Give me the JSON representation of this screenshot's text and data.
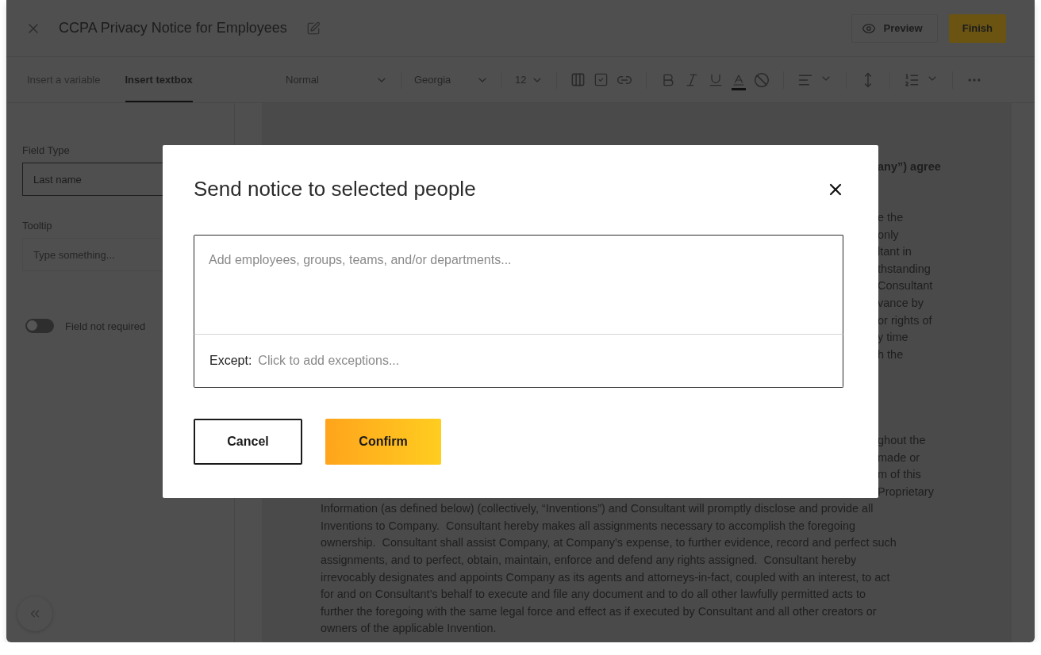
{
  "header": {
    "title": "CCPA Privacy Notice for Employees",
    "buttons": [
      {
        "label": "Preview",
        "kind": "secondary"
      },
      {
        "label": "Finish",
        "kind": "primary"
      }
    ]
  },
  "tabs": [
    {
      "label": "Insert a variable",
      "selected": false
    },
    {
      "label": "Insert textbox",
      "selected": true
    }
  ],
  "toolbar": {
    "dropdowns": [
      {
        "value": "Normal"
      },
      {
        "value": "Georgia"
      },
      {
        "value": "12"
      }
    ]
  },
  "side_panel": {
    "field_type": {
      "label": "Field Type",
      "value": "Last name"
    },
    "tooltip": {
      "label": "Tooltip",
      "placeholder": "Type something..."
    },
    "required_toggle": {
      "label": "Field not required",
      "on": false
    }
  },
  "document": {
    "heading_fragment": "any”) agree",
    "fragments_upper": [
      "e the",
      "only",
      "ltant in",
      "thstanding",
      "Consultant",
      "vance by",
      "or rights of",
      "y time",
      "h the"
    ],
    "fragments_lower": [
      "ghout the",
      "made or",
      "m of this",
      "Proprietary"
    ],
    "lines": [
      "Information (as defined below) (collectively, “Inventions”) and Consultant will promptly disclose and provide all",
      "Inventions to Company.  Consultant hereby makes all assignments necessary to accomplish the foregoing",
      "ownership.  Consultant shall assist Company, at Company’s expense, to further evidence, record and perfect such",
      "assignments, and to perfect, obtain, maintain, enforce and defend any rights assigned.  Consultant hereby",
      "irrevocably designates and appoints Company as its agents and attorneys-in-fact, coupled with an interest, to act",
      "for and on Consultant’s behalf to execute and file any document and to do all other lawfully permitted acts to",
      "further the foregoing with the same legal force and effect as if executed by Consultant and all other creators or",
      "owners of the applicable Invention."
    ]
  },
  "modal": {
    "title": "Send notice to selected people",
    "recipients": {
      "placeholder": "Add employees, groups, teams, and/or departments..."
    },
    "exceptions": {
      "label": "Except:",
      "placeholder": "Click to add exceptions..."
    },
    "buttons": [
      {
        "label": "Cancel",
        "kind": "secondary"
      },
      {
        "label": "Confirm",
        "kind": "primary"
      }
    ]
  }
}
